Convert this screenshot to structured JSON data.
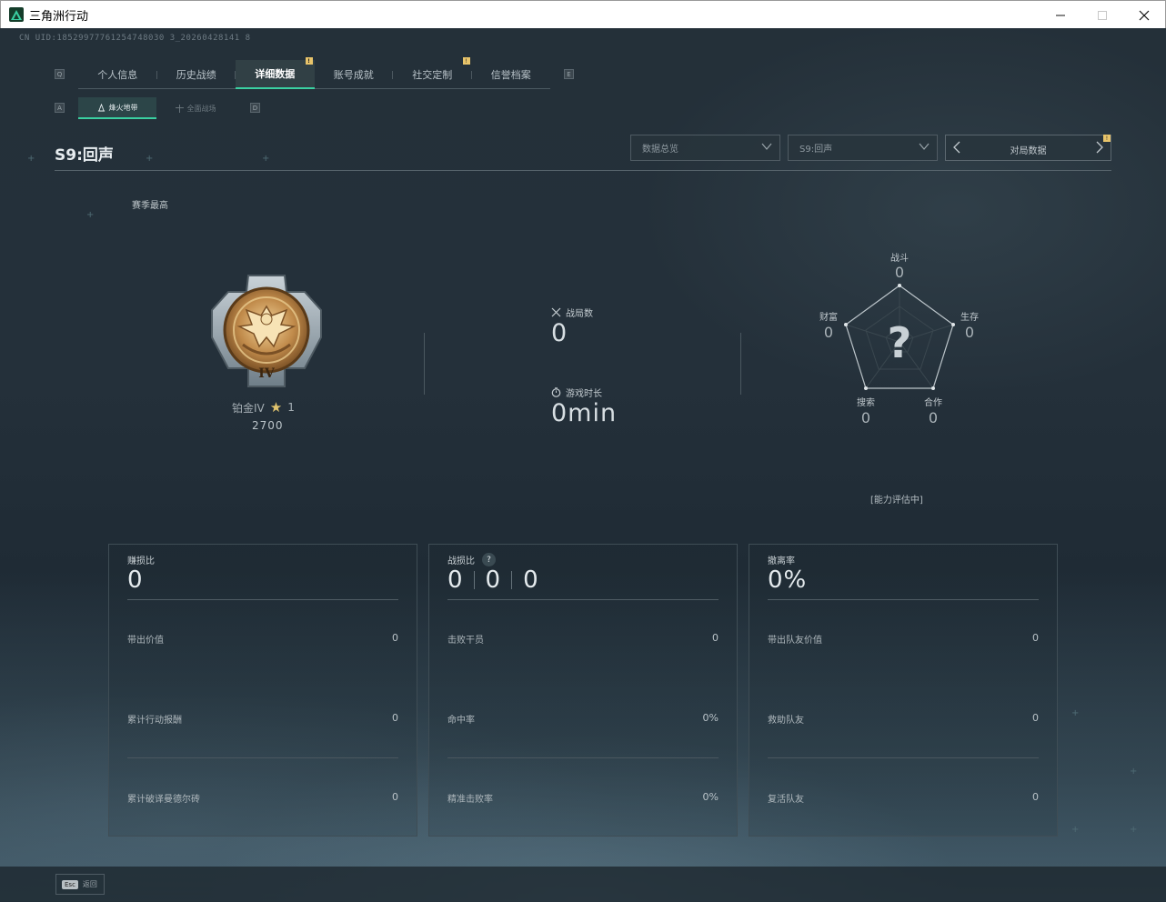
{
  "window": {
    "title": "三角洲行动",
    "buttons": [
      "minimize",
      "maximize",
      "close"
    ]
  },
  "header": {
    "uid": "CN UID:18529977761254748030 3_20260428141 8",
    "main_tabs": [
      {
        "label": "个人信息",
        "active": false,
        "badge": false
      },
      {
        "label": "历史战绩",
        "active": false,
        "badge": false
      },
      {
        "label": "详细数据",
        "active": true,
        "badge": true
      },
      {
        "label": "账号成就",
        "active": false,
        "badge": false
      },
      {
        "label": "社交定制",
        "active": false,
        "badge": true
      },
      {
        "label": "信誉档案",
        "active": false,
        "badge": false
      }
    ],
    "key_left": "Q",
    "key_right": "E",
    "sub_tabs": [
      {
        "label": "烽火地带",
        "active": true
      },
      {
        "label": "全面战场",
        "active": false
      }
    ],
    "sub_key_left": "A",
    "sub_key_right": "D"
  },
  "season": {
    "title": "S9:回声",
    "dropdowns": [
      {
        "value": "数据总览"
      },
      {
        "value": "S9:回声"
      }
    ],
    "pager_label": "对局数据",
    "best_label": "赛季最高"
  },
  "rank": {
    "name": "铂金IV",
    "stars": "1",
    "points": "2700",
    "medal_numeral": "IV"
  },
  "summary": {
    "matches_label": "战局数",
    "matches_value": "0",
    "playtime_label": "游戏时长",
    "playtime_value": "0min"
  },
  "radar": {
    "axes": [
      {
        "label": "战斗",
        "value": "0"
      },
      {
        "label": "生存",
        "value": "0"
      },
      {
        "label": "合作",
        "value": "0"
      },
      {
        "label": "搜索",
        "value": "0"
      },
      {
        "label": "财富",
        "value": "0"
      }
    ],
    "center_glyph": "?",
    "status": "[能力评估中]"
  },
  "cards": [
    {
      "head_label": "赚损比",
      "head_value": "0",
      "rows": [
        {
          "label": "带出价值",
          "value": "0"
        },
        {
          "label": "累计行动报酬",
          "value": "0"
        },
        {
          "label": "累计破译曼德尔砖",
          "value": "0"
        }
      ]
    },
    {
      "head_label": "战损比",
      "head_values": [
        "0",
        "0",
        "0"
      ],
      "help": "?",
      "rows": [
        {
          "label": "击败干员",
          "value": "0"
        },
        {
          "label": "命中率",
          "value": "0%"
        },
        {
          "label": "精准击败率",
          "value": "0%"
        }
      ]
    },
    {
      "head_label": "撤离率",
      "head_value": "0%",
      "rows": [
        {
          "label": "带出队友价值",
          "value": "0"
        },
        {
          "label": "救助队友",
          "value": "0"
        },
        {
          "label": "复活队友",
          "value": "0"
        }
      ]
    }
  ],
  "footer": {
    "esc_key": "Esc",
    "esc_label": "返回"
  },
  "colors": {
    "accent": "#3ad0a1",
    "badge": "#e8c46a",
    "star": "#e2c56e"
  }
}
